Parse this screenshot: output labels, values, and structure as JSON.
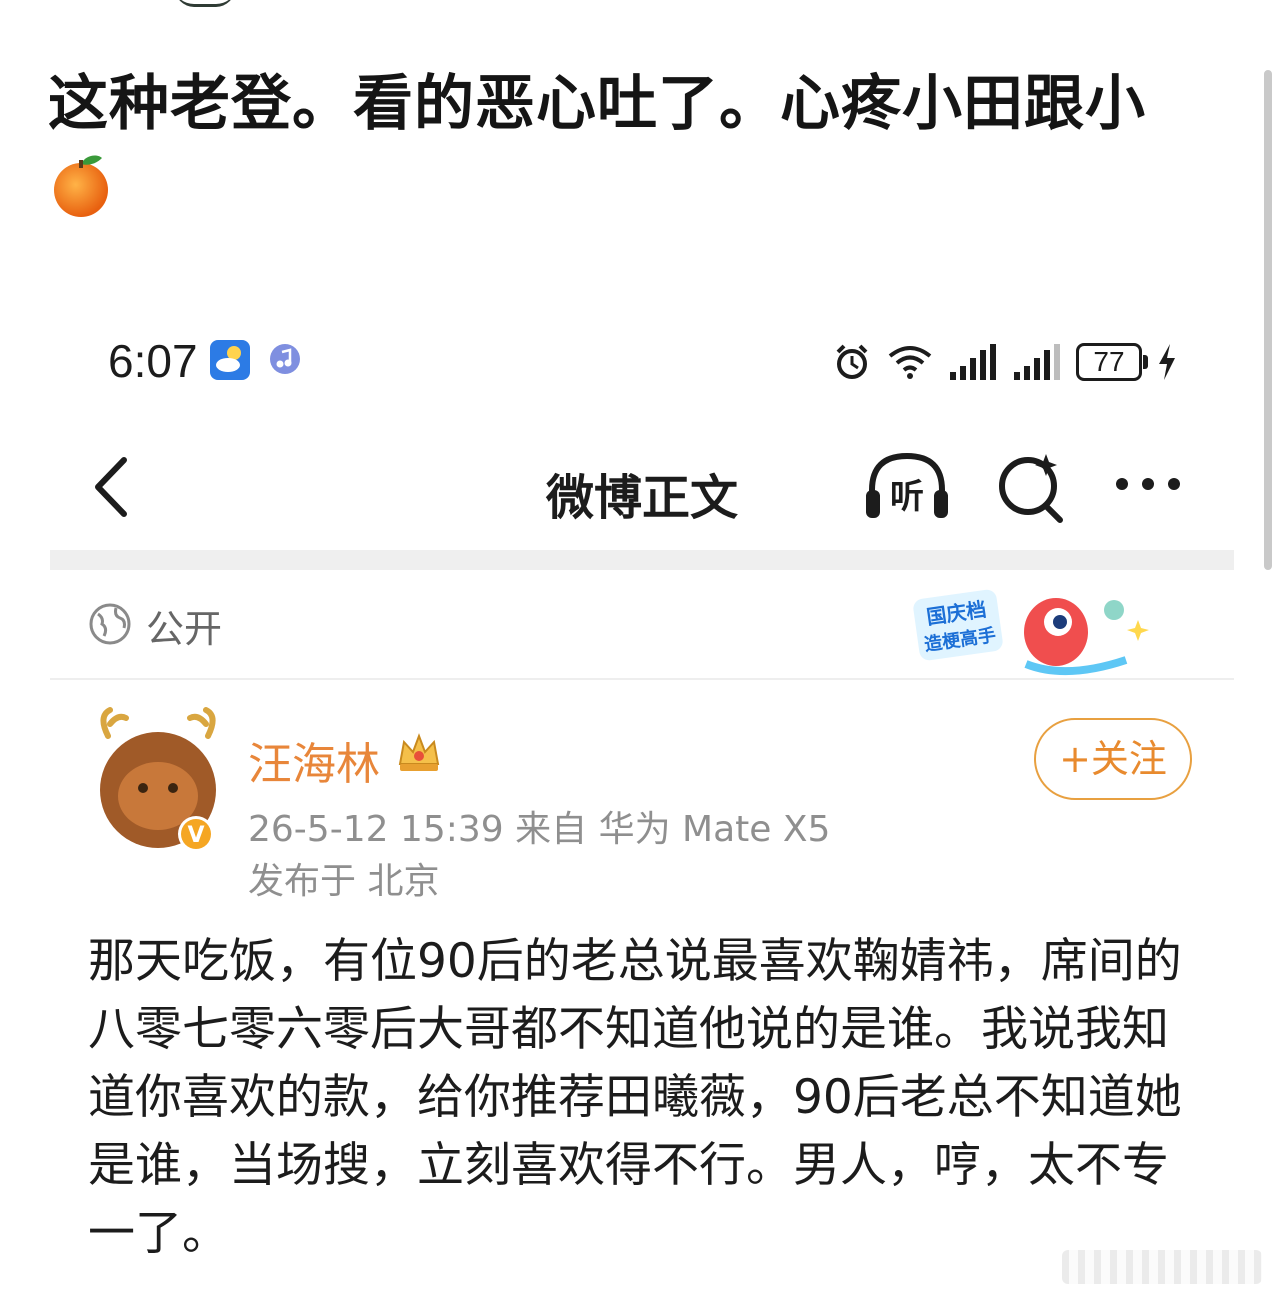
{
  "caption": {
    "text": "这种老登。看的恶心吐了。心疼小田跟小",
    "emoji": "orange-emoji"
  },
  "status_bar": {
    "time": "6:07",
    "battery": "77",
    "icons": [
      "weather-icon",
      "music-icon",
      "alarm-icon",
      "wifi-icon",
      "signal-icon",
      "signal-icon",
      "charging-icon"
    ]
  },
  "nav": {
    "title": "微博正文",
    "listen_label": "听"
  },
  "visibility": {
    "label": "公开"
  },
  "promo": {
    "line1": "国庆档",
    "line2": "造梗高手"
  },
  "post": {
    "author": "汪海林",
    "follow_label": "+关注",
    "meta_line1": "26-5-12 15:39   来自 华为 Mate X5",
    "meta_line2": "发布于 北京",
    "avatar_badge": "V",
    "body": "那天吃饭，有位90后的老总说最喜欢鞠婧祎，席间的八零七零六零后大哥都不知道他说的是谁。我说我知道你喜欢的款，给你推荐田曦薇，90后老总不知道她是谁，当场搜，立刻喜欢得不行。男人，哼，太不专一了。"
  },
  "colors": {
    "accent_orange": "#e8863a",
    "follow_border": "#e8a040",
    "meta_gray": "#8f8f8f"
  }
}
